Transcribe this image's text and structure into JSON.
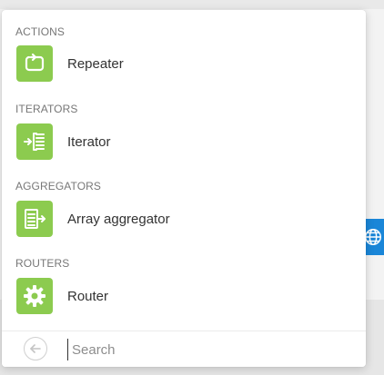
{
  "menu": {
    "sections": [
      {
        "heading": "ACTIONS",
        "items": [
          {
            "label": "Repeater",
            "icon": "repeater-icon"
          }
        ]
      },
      {
        "heading": "ITERATORS",
        "items": [
          {
            "label": "Iterator",
            "icon": "iterator-icon"
          }
        ]
      },
      {
        "heading": "AGGREGATORS",
        "items": [
          {
            "label": "Array aggregator",
            "icon": "array-aggregator-icon"
          }
        ]
      },
      {
        "heading": "ROUTERS",
        "items": [
          {
            "label": "Router",
            "icon": "gear-icon"
          }
        ]
      }
    ]
  },
  "search": {
    "placeholder": "Search",
    "value": ""
  },
  "colors": {
    "tile": "#8ccb4f",
    "heading": "#777777",
    "label": "#333333",
    "globe_tab": "#1a86d8"
  },
  "canvas": {
    "globe_icon": "globe-icon"
  }
}
